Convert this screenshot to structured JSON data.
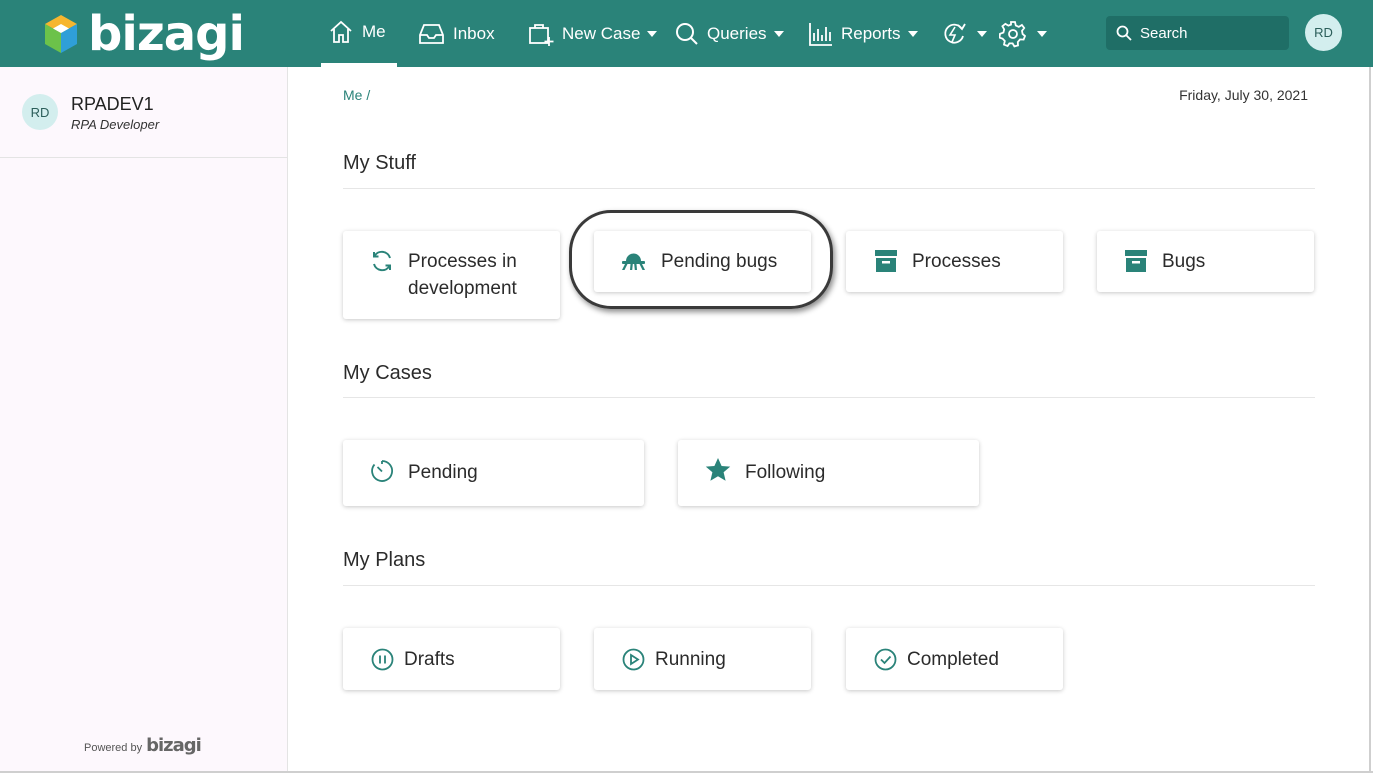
{
  "header": {
    "logo_text": "bizagi",
    "nav": {
      "me": "Me",
      "inbox": "Inbox",
      "new_case": "New Case",
      "queries": "Queries",
      "reports": "Reports"
    },
    "search_placeholder": "Search",
    "avatar_initials": "RD",
    "bar_color": "#2a8379"
  },
  "sidebar": {
    "avatar_initials": "RD",
    "user_name": "RPADEV1",
    "user_role": "RPA Developer",
    "powered_by": "Powered by",
    "powered_brand": "bizagi"
  },
  "main": {
    "breadcrumb": "Me /",
    "date": "Friday, July 30, 2021",
    "sections": {
      "my_stuff": {
        "title": "My Stuff",
        "cards": [
          {
            "label": "Processes in development",
            "icon": "refresh-icon"
          },
          {
            "label": "Pending bugs",
            "icon": "bug-icon"
          },
          {
            "label": "Processes",
            "icon": "archive-icon"
          },
          {
            "label": "Bugs",
            "icon": "archive-icon"
          }
        ]
      },
      "my_cases": {
        "title": "My Cases",
        "cards": [
          {
            "label": "Pending",
            "icon": "timer-icon"
          },
          {
            "label": "Following",
            "icon": "star-icon"
          }
        ]
      },
      "my_plans": {
        "title": "My Plans",
        "cards": [
          {
            "label": "Drafts",
            "icon": "pause-circle-icon"
          },
          {
            "label": "Running",
            "icon": "play-circle-icon"
          },
          {
            "label": "Completed",
            "icon": "check-circle-icon"
          }
        ]
      }
    }
  },
  "accent_color": "#2a8379"
}
